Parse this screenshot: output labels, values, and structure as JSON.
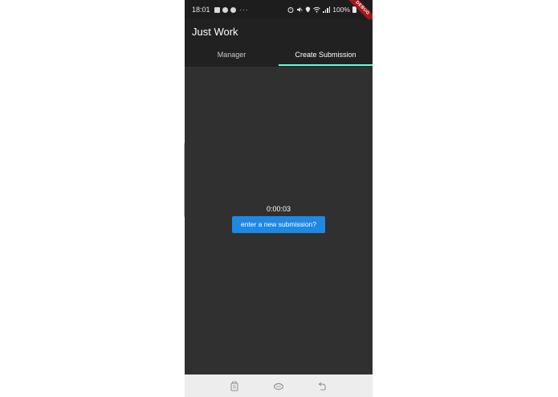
{
  "status_bar": {
    "time": "18:01",
    "more": "···",
    "battery_text": "100%",
    "debug_label": "DEBUG",
    "icons": [
      "message-icon",
      "vpn-icon",
      "location-circle-icon",
      "alarm-icon",
      "mute-icon",
      "location-icon",
      "wifi-icon",
      "signal-icon",
      "battery-icon"
    ]
  },
  "app_bar": {
    "title": "Just Work"
  },
  "tabs": [
    {
      "label": "Manager",
      "active": false
    },
    {
      "label": "Create Submission",
      "active": true
    }
  ],
  "main": {
    "timer": "0:00:03",
    "button_label": "enter a new submission?"
  },
  "nav_bar": {
    "icons": [
      "recent-apps-icon",
      "home-icon",
      "back-icon"
    ]
  },
  "colors": {
    "background": "#303030",
    "app_bar": "#212121",
    "tab_indicator": "#64ffda",
    "button": "#1e88e5",
    "debug_banner": "#a2171e"
  }
}
